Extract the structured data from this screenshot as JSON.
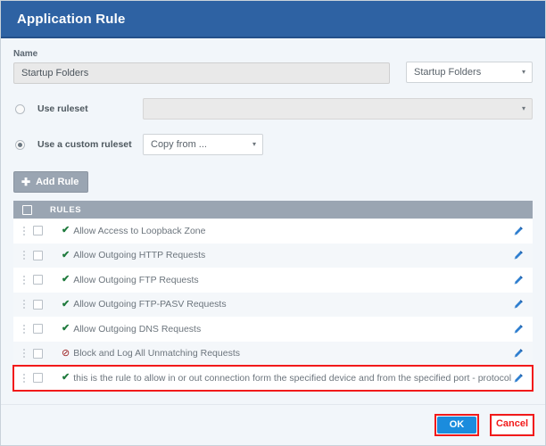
{
  "window": {
    "title": "Application Rule"
  },
  "form": {
    "name_label": "Name",
    "name_value": "Startup Folders",
    "name_placeholder": "Name",
    "profile_select_value": "Startup Folders",
    "caret_glyph": "▾"
  },
  "ruleset": {
    "use_ruleset_label": "Use ruleset",
    "use_ruleset_selected": false,
    "use_ruleset_value": "",
    "use_custom_label": "Use a custom ruleset",
    "use_custom_selected": true,
    "copy_from_value": "Copy from ..."
  },
  "toolbar": {
    "add_rule_label": "Add Rule",
    "plus_glyph": "✚"
  },
  "table": {
    "header_label": "RULES",
    "allow_glyph": "✔",
    "block_glyph": "⊘",
    "rows": [
      {
        "text": "Allow Access to Loopback Zone",
        "kind": "allow",
        "checked": false,
        "highlighted": false
      },
      {
        "text": "Allow Outgoing HTTP Requests",
        "kind": "allow",
        "checked": false,
        "highlighted": false
      },
      {
        "text": "Allow Outgoing FTP Requests",
        "kind": "allow",
        "checked": false,
        "highlighted": false
      },
      {
        "text": "Allow Outgoing FTP-PASV Requests",
        "kind": "allow",
        "checked": false,
        "highlighted": false
      },
      {
        "text": "Allow Outgoing DNS Requests",
        "kind": "allow",
        "checked": false,
        "highlighted": false
      },
      {
        "text": "Block and Log All Unmatching Requests",
        "kind": "block",
        "checked": false,
        "highlighted": false
      },
      {
        "text": "this is the rule to allow in or out connection form the specified device and from the specified port - protocol tcp or ip",
        "kind": "allow",
        "checked": false,
        "highlighted": true
      }
    ]
  },
  "footer": {
    "ok_label": "OK",
    "cancel_label": "Cancel"
  },
  "colors": {
    "titlebar_blue": "#2e62a3",
    "header_gray": "#9aa5b2",
    "ok_blue": "#1b8cdd",
    "annotation_red": "#f21a1a",
    "allow_green": "#1f7a3d",
    "block_red": "#9b1c1c",
    "pencil_blue": "#2f7fd0",
    "background": "#f2f6fa"
  }
}
